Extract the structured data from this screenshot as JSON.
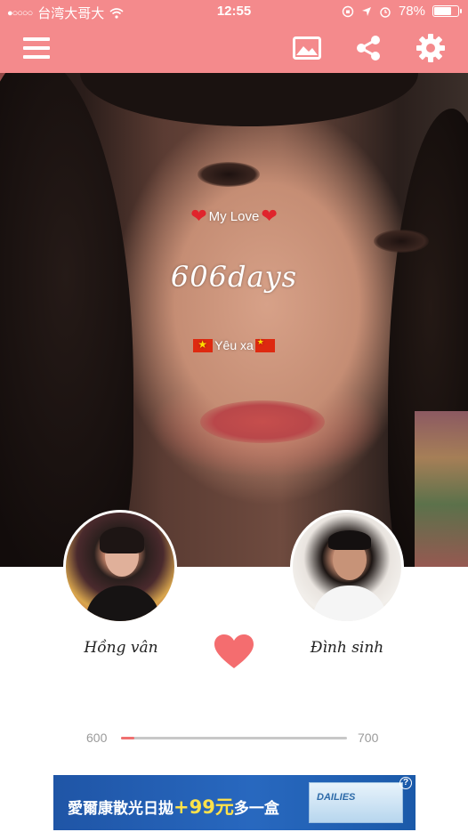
{
  "status_bar": {
    "signal_dots": "●○○○○",
    "carrier": "台湾大哥大",
    "wifi_icon": "wifi-icon",
    "time": "12:55",
    "battery_percent": "78%",
    "battery_level": 0.78
  },
  "toolbar": {
    "menu_icon": "hamburger-menu-icon",
    "actions": [
      "image-icon",
      "share-icon",
      "settings-gear-icon"
    ]
  },
  "overlay": {
    "title": "My Love",
    "days": "606days",
    "subtitle": "Yêu xa"
  },
  "couple": {
    "person_a": {
      "name": "Hồng vân"
    },
    "person_b": {
      "name": "Đình sinh"
    }
  },
  "progress": {
    "min": "600",
    "max": "700",
    "value": 606
  },
  "colors": {
    "header": "#f48a8c",
    "heart": "#f46d6f",
    "progress_fill": "#f07070"
  },
  "ad": {
    "text_prefix": "愛爾康散光日拋",
    "text_price": "+99元",
    "text_suffix": "多一盒",
    "product_brand": "DAILIES",
    "info_label": "?"
  }
}
